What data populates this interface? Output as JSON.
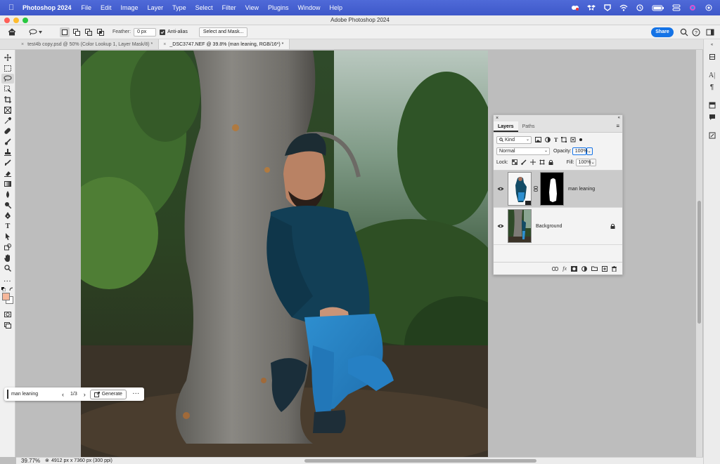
{
  "menubar": {
    "app_name": "Photoshop 2024",
    "items": [
      "File",
      "Edit",
      "Image",
      "Layer",
      "Type",
      "Select",
      "Filter",
      "View",
      "Plugins",
      "Window",
      "Help"
    ],
    "status_icons": [
      "creative-cloud-icon",
      "dropbox-icon",
      "location-icon",
      "wifi-icon",
      "time-machine-icon",
      "battery-icon",
      "control-center-icon",
      "siri-icon",
      "screen-record-icon"
    ]
  },
  "window": {
    "title": "Adobe Photoshop 2024"
  },
  "options_bar": {
    "feather_label": "Feather:",
    "feather_value": "0 px",
    "antialias_label": "Anti-alias",
    "antialias_checked": true,
    "select_mask_label": "Select and Mask...",
    "share_label": "Share"
  },
  "tabs": [
    {
      "label": "test4b copy.psd @ 50% (Color Lookup 1, Layer Mask/8) *"
    },
    {
      "label": "_DSC3747.NEF @ 39.8% (man leaning, RGB/16*) *"
    }
  ],
  "context_bar": {
    "prompt_value": "man leaning",
    "page_indicator": "1/3",
    "generate_label": "Generate"
  },
  "layers_panel": {
    "tabs": [
      "Layers",
      "Paths"
    ],
    "filter_kind": "Kind",
    "blend_mode": "Normal",
    "opacity_label": "Opacity:",
    "opacity_value": "100%",
    "lock_label": "Lock:",
    "fill_label": "Fill:",
    "fill_value": "100%",
    "layers": [
      {
        "name": "man leaning",
        "selected": true,
        "visible": true
      },
      {
        "name": "Background",
        "selected": false,
        "visible": true,
        "locked": true
      }
    ]
  },
  "status_bar": {
    "zoom": "39.77%",
    "doc_info": "4912 px x 7360 px (300 ppi)"
  },
  "colors": {
    "menubar": "#4562d0",
    "share_button": "#1473e6",
    "foreground_swatch": "#f6b79a",
    "background_swatch": "#ffffff"
  }
}
